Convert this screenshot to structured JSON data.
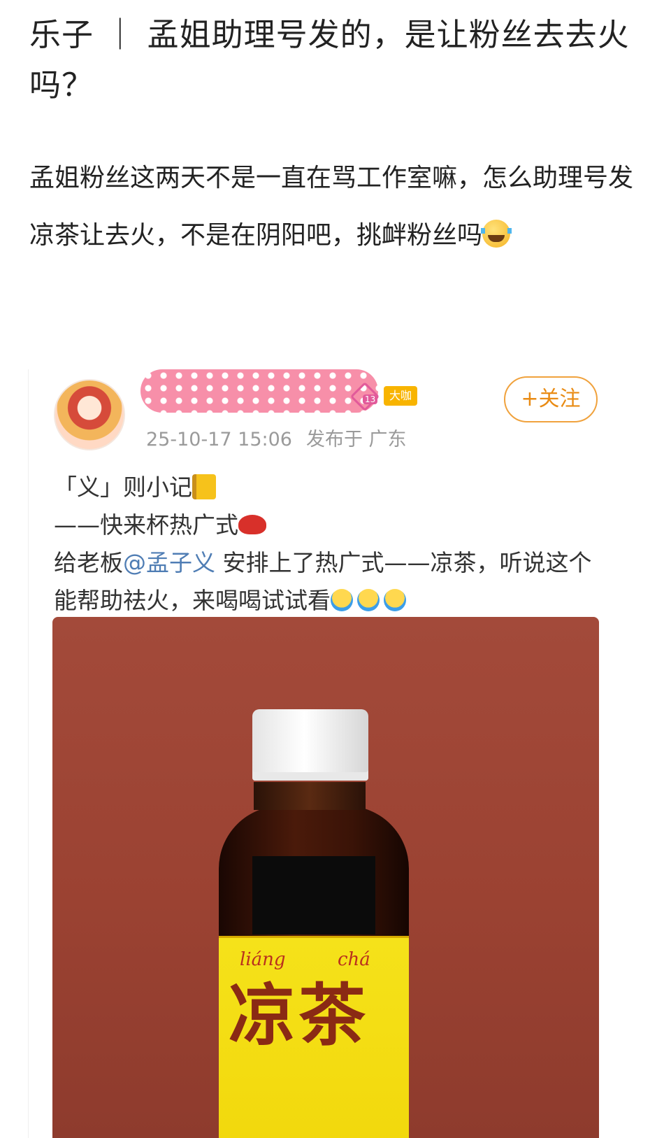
{
  "article": {
    "title": "乐子 ｜ 孟姐助理号发的，是让粉丝去去火吗？",
    "body": "孟姐粉丝这两天不是一直在骂工作室嘛，怎么助理号发凉茶让去火，不是在阴阳吧，挑衅粉丝吗",
    "body_emoji": "laugh-cry-emoji"
  },
  "weibo_card": {
    "level": "13",
    "vip_label": "大咖",
    "follow_label": "+关注",
    "timestamp": "25-10-17 15:06",
    "location": "发布于 广东",
    "lines": {
      "line1": "「义」则小记",
      "line2": "——快来杯热广式",
      "line3_prefix": "给老板",
      "mention": "@孟子义",
      "line3_suffix": " 安排上了热广式——凉茶，听说这个能帮助祛火，来喝喝试试看"
    },
    "photo": {
      "pinyin_left": "liáng",
      "pinyin_right": "chá",
      "label_text": "凉茶"
    }
  },
  "colors": {
    "follow_orange": "#f0a23d",
    "mention_blue": "#4f7db4",
    "vip_gold": "#f8b400",
    "label_yellow": "#f5e21a"
  }
}
